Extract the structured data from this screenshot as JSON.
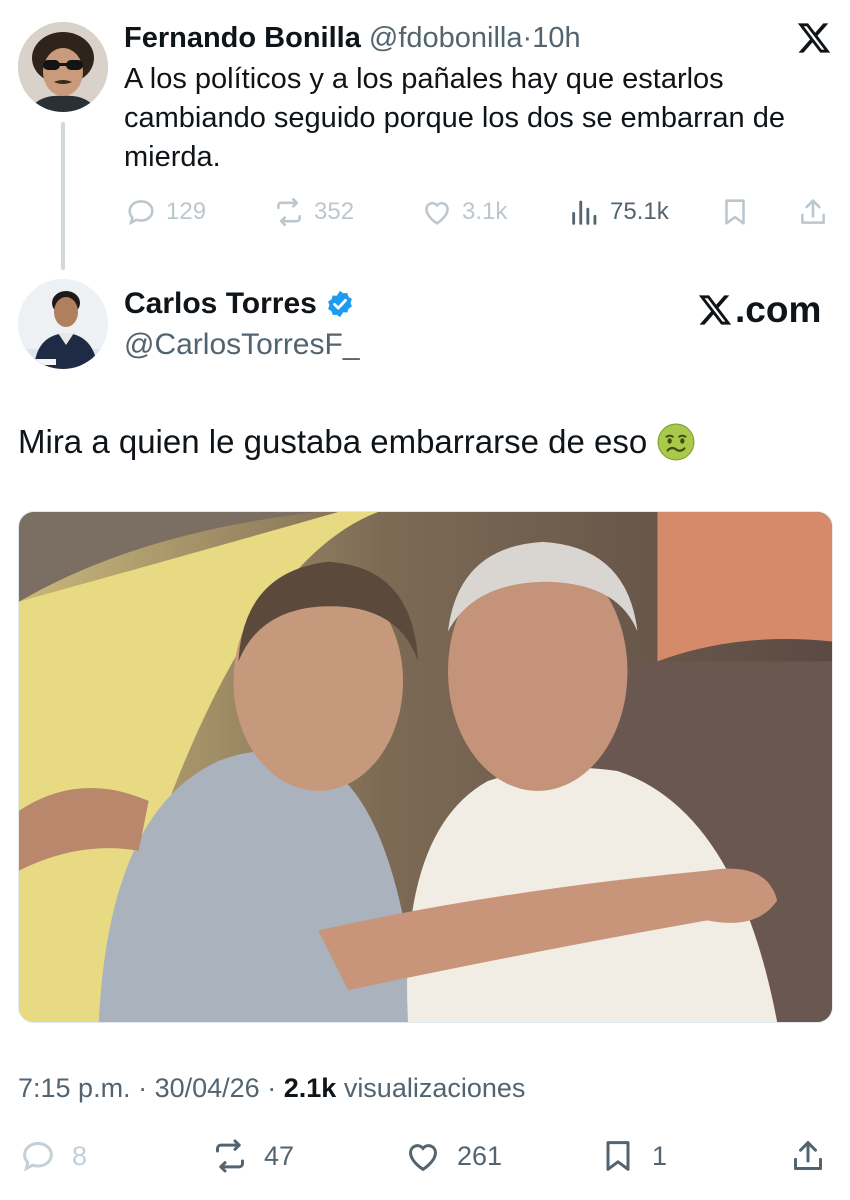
{
  "parent_tweet": {
    "name": "Fernando Bonilla",
    "handle": "@fdobonilla",
    "separator": "·",
    "time": "10h",
    "text": "A los políticos y a los pañales hay que estarlos cambiando seguido porque los dos se embarran de mierda.",
    "replies": "129",
    "retweets": "352",
    "likes": "3.1k",
    "views": "75.1k"
  },
  "main_tweet": {
    "name": "Carlos Torres",
    "handle": "@CarlosTorresF_",
    "watermark": ".com",
    "text": "Mira a quien le gustaba embarrarse de eso",
    "time": "7:15 p.m.",
    "date": "30/04/26",
    "separator": "·",
    "views_count": "2.1k",
    "views_label": "visualizaciones",
    "replies": "8",
    "retweets": "47",
    "likes": "261",
    "bookmarks": "1"
  },
  "colors": {
    "text_primary": "#0f1419",
    "text_secondary": "#536471",
    "faded_icon": "#bcc6cd",
    "verified_blue": "#1d9bf0",
    "thread_line": "#cfd9de"
  },
  "icons": {
    "x_logo": "x-logo-icon",
    "verified": "verified-badge-icon",
    "emoji": "nauseated-face-emoji"
  }
}
